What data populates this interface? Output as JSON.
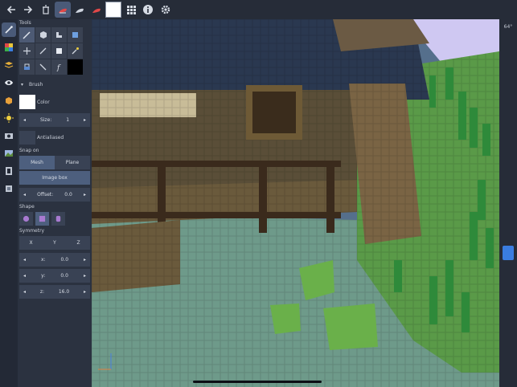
{
  "panel": {
    "tools_label": "Tools",
    "brush_label": "Brush",
    "color_label": "Color",
    "size_label": "Size:",
    "size_value": "1",
    "antialiased_label": "Antialiased",
    "snap_label": "Snap on",
    "snap_mesh": "Mesh",
    "snap_plane": "Plane",
    "image_box": "Image box",
    "offset_label": "Offset:",
    "offset_value": "0.0",
    "shape_label": "Shape",
    "symmetry_label": "Symmetry",
    "sym_x": "X",
    "sym_y": "Y",
    "sym_z": "Z",
    "x_label": "x:",
    "x_value": "0.0",
    "y_label": "y:",
    "y_value": "0.0",
    "z_label": "z:",
    "z_value": "16.0",
    "dec_symbol": "◂",
    "inc_symbol": "▸"
  },
  "viewport": {
    "fov_label": "64°"
  },
  "colors": {
    "accent": "#3a7de0",
    "current_color": "#ffffff",
    "panel_bg": "#2b3240",
    "toolbar_bg": "#262c38"
  }
}
